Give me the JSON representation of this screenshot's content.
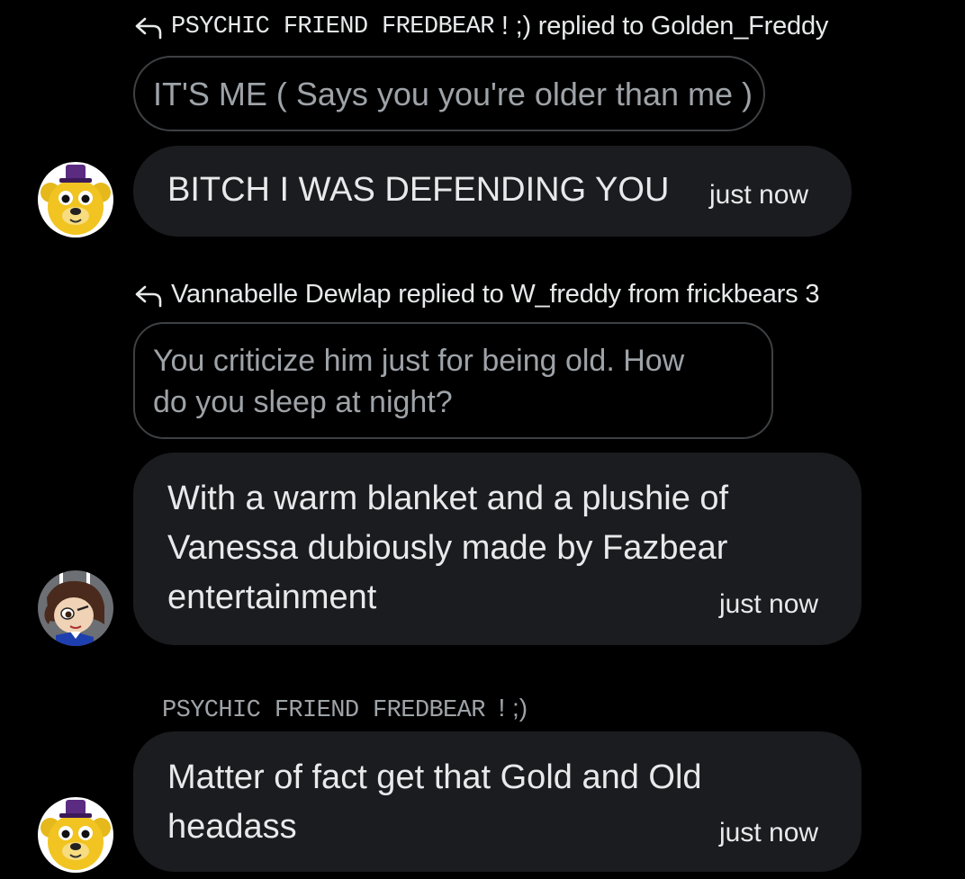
{
  "messages": [
    {
      "reply_context": {
        "sender": "PSYCHIC FRIEND FREDBEAR",
        "sender_suffix": "! ;) replied to Golden_Freddy"
      },
      "quoted_text": "IT'S ME ( Says you you're older than me )",
      "text": "BITCH I WAS DEFENDING YOU",
      "timestamp": "just now",
      "avatar": "golden-freddy-avatar"
    },
    {
      "reply_context": {
        "text": "Vannabelle Dewlap replied to W_freddy from frickbears 3"
      },
      "quoted_text_lines": [
        "You criticize him just for being old. How",
        "do you sleep at night?"
      ],
      "text_lines": [
        "With a warm blanket and a plushie of",
        "Vanessa dubiously made by Fazbear",
        "entertainment"
      ],
      "timestamp": "just now",
      "avatar": "vannabelle-avatar"
    },
    {
      "sender": "PSYCHIC FRIEND FREDBEAR",
      "sender_suffix": "! ;)",
      "text_lines": [
        "Matter of fact get that Gold and Old",
        "headass"
      ],
      "timestamp": "just now",
      "avatar": "golden-freddy-avatar"
    }
  ],
  "colors": {
    "background": "#000000",
    "bubble": "#1b1c1f",
    "quote_border": "#3e4144",
    "muted_text": "#9ea3a8",
    "primary_text": "#e7e9ea"
  }
}
